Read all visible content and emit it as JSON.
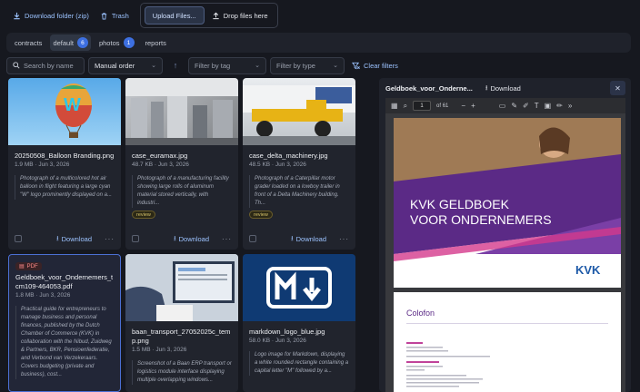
{
  "toolbar": {
    "download_folder": "Download folder (zip)",
    "trash": "Trash",
    "upload_files": "Upload Files...",
    "drop_files": "Drop files here"
  },
  "tabs": [
    {
      "label": "contracts",
      "count": null
    },
    {
      "label": "default",
      "count": "6"
    },
    {
      "label": "photos",
      "count": "1"
    },
    {
      "label": "reports",
      "count": null
    }
  ],
  "filters": {
    "search_placeholder": "Search by name",
    "sort": "Manual order",
    "tag_placeholder": "Filter by tag",
    "type_placeholder": "Filter by type",
    "clear": "Clear filters"
  },
  "cards": [
    {
      "name": "20250508_Balloon Branding.png",
      "meta": "1.9 MB · Jun 3, 2026",
      "desc": "Photograph of a multicolored hot air balloon in flight featuring a large cyan \"W\" logo prominently displayed on a...",
      "review": null,
      "download": "Download"
    },
    {
      "name": "case_euramax.jpg",
      "meta": "48.7 KB · Jun 3, 2026",
      "desc": "Photograph of a manufacturing facility showing large rolls of aluminum material stored vertically, with industri...",
      "review": "review",
      "download": "Download"
    },
    {
      "name": "case_delta_machinery.jpg",
      "meta": "48.5 KB · Jun 3, 2026",
      "desc": "Photograph of a Caterpillar motor grader loaded on a lowboy trailer in front of a Delta Machinery building. Th...",
      "review": "review",
      "download": "Download"
    },
    {
      "name": "Geldboek_voor_Ondernemers_tcm109-464053.pdf",
      "meta": "1.8 MB · Jun 3, 2026",
      "badge": "PDF",
      "desc": "Practical guide for entrepreneurs to manage business and personal finances, published by the Dutch Chamber of Commerce (KVK) in collaboration with the Nibud, Zuidweg & Partners, BKR, Pensioenfederatie, and Verbond van Verzekeraars. Covers budgeting (private and business), cost..."
    },
    {
      "name": "baan_transport_27052025c_temp.png",
      "meta": "1.5 MB · Jun 3, 2026",
      "desc": "Screenshot of a Baan ERP transport or logistics module interface displaying multiple overlapping windows..."
    },
    {
      "name": "markdown_logo_blue.jpg",
      "meta": "58.0 KB · Jun 3, 2026",
      "desc": "Logo image for Markdown, displaying a white rounded rectangle containing a capital letter \"M\" followed by a..."
    }
  ],
  "preview": {
    "title": "Geldboek_voor_Onderne...",
    "download": "Download",
    "page_current": "1",
    "page_total": "of 61",
    "cover_title_1": "KVK GELDBOEK",
    "cover_title_2": "VOOR ONDERNEMERS",
    "brand": "KVK",
    "page2_title": "Colofon"
  },
  "colors": {
    "accent": "#3d6fe0",
    "link": "#9cc3ff",
    "kvk_purple": "#5b2a86",
    "kvk_blue": "#1e5aa8"
  }
}
